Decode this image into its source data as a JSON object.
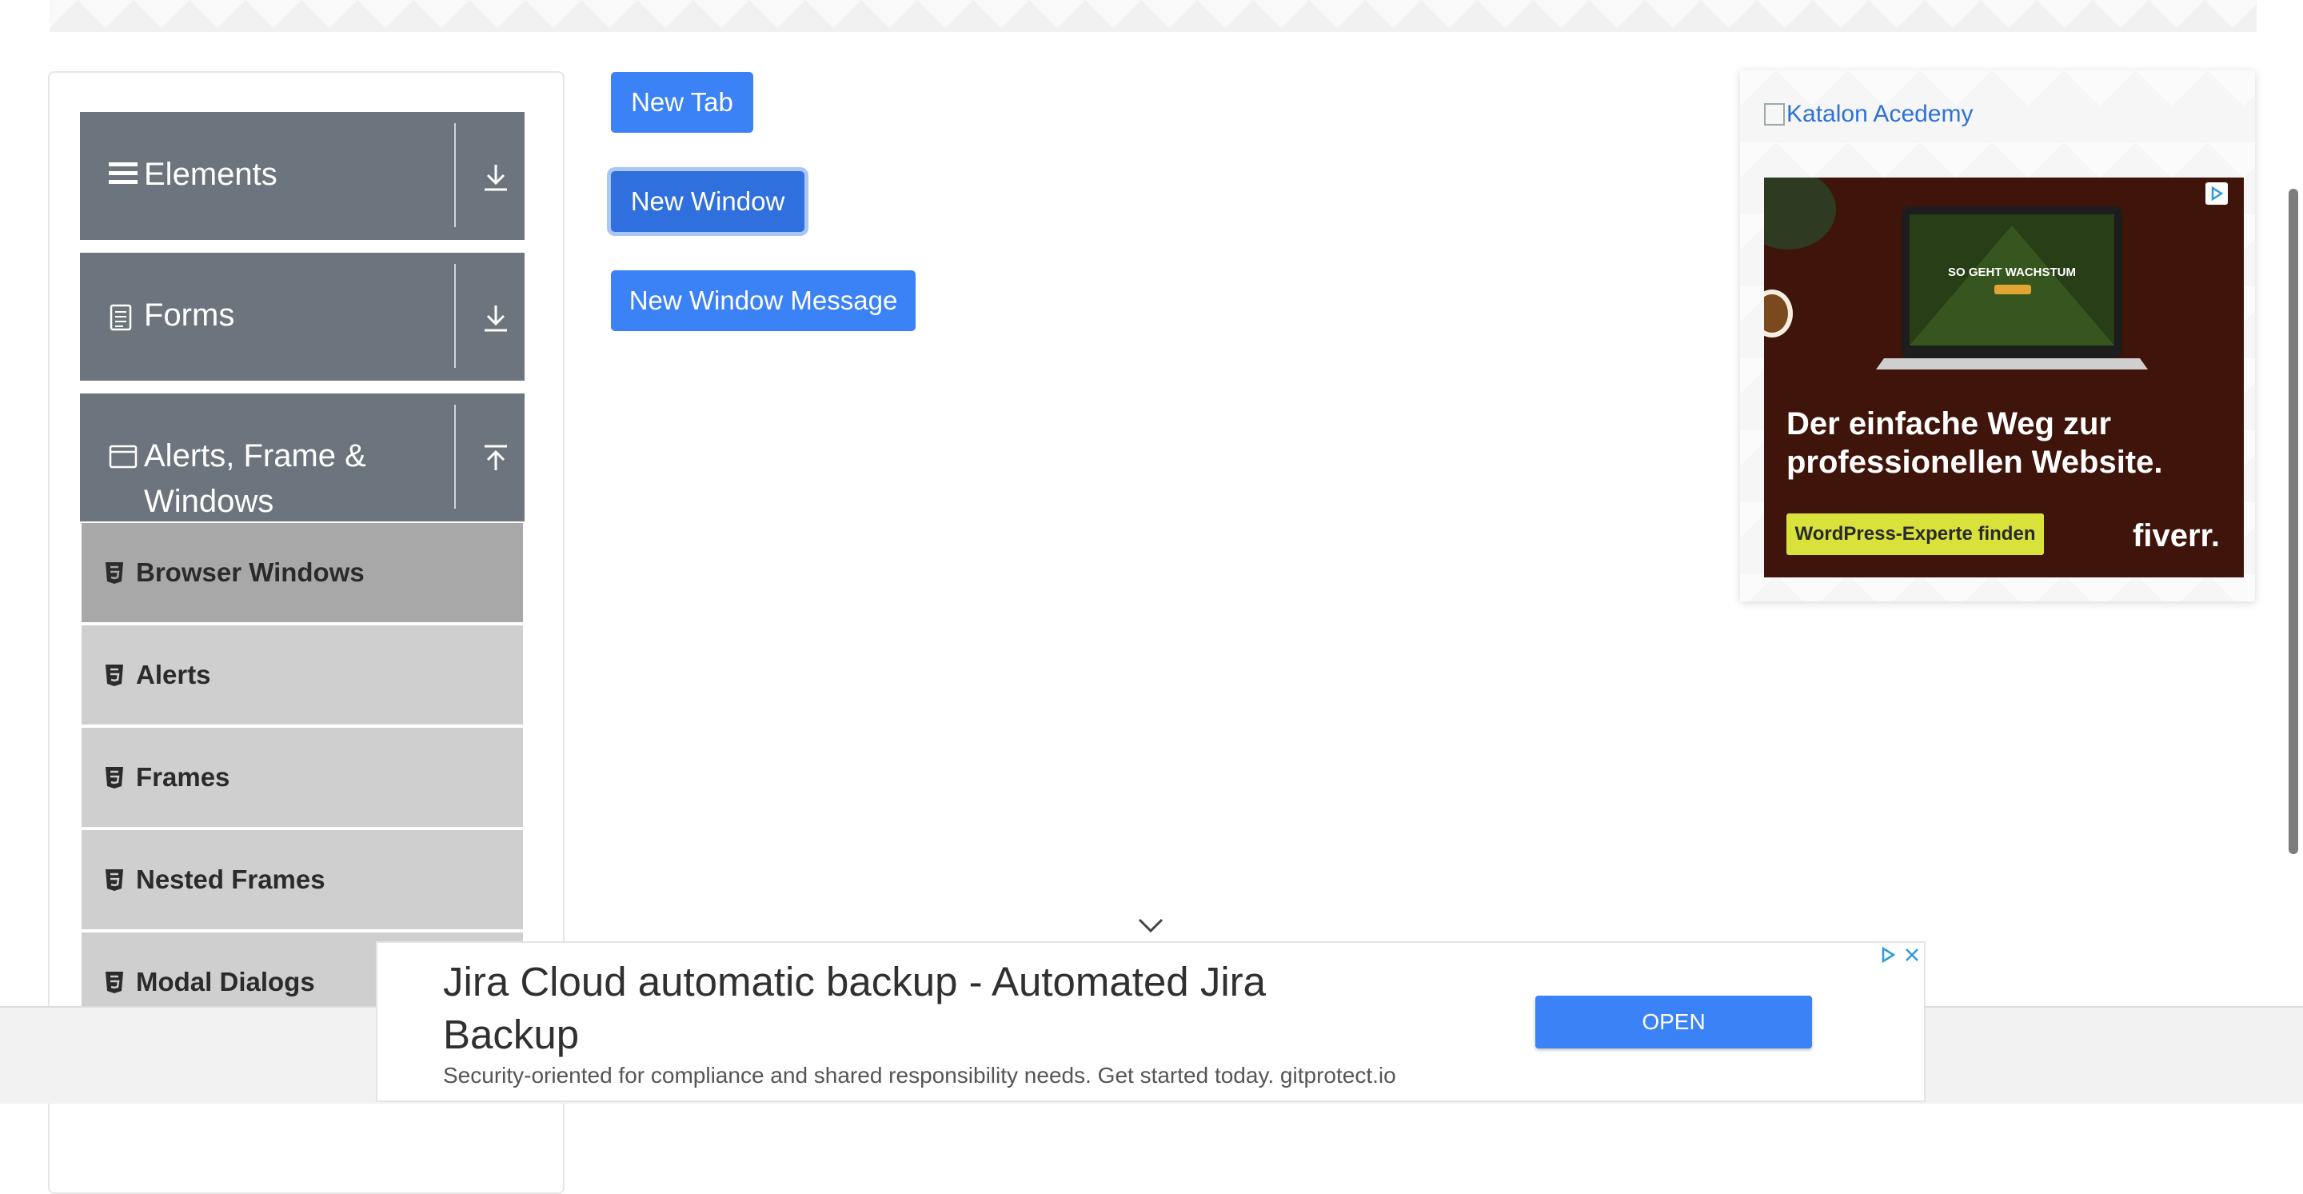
{
  "sidebar": {
    "groups": [
      {
        "label": "Elements",
        "icon": "hamburger-icon",
        "toggle": "download-icon"
      },
      {
        "label": "Forms",
        "icon": "document-icon",
        "toggle": "download-icon"
      },
      {
        "label_line1": "Alerts, Frame &",
        "label_line2": "Windows",
        "icon": "window-icon",
        "toggle": "upload-icon"
      }
    ],
    "items": [
      {
        "label": "Browser Windows",
        "active": true
      },
      {
        "label": "Alerts"
      },
      {
        "label": "Frames"
      },
      {
        "label": "Nested Frames"
      },
      {
        "label": "Modal Dialogs"
      }
    ]
  },
  "main": {
    "buttons": {
      "new_tab": "New Tab",
      "new_window": "New Window",
      "new_window_message": "New Window Message"
    }
  },
  "side_ad": {
    "link_text": "Katalon Acedemy",
    "screen_text": "SO GEHT WACHSTUM",
    "headline": "Der einfache Weg zur professionellen Website.",
    "cta": "WordPress-Experte finden",
    "brand": "fiverr."
  },
  "bottom_ad": {
    "title": "Jira Cloud automatic backup - Automated Jira Backup",
    "description": "Security-oriented for compliance and shared responsibility needs. Get started today. gitprotect.io",
    "cta": "OPEN"
  },
  "colors": {
    "sidebar_header": "#6c757d",
    "menu_item": "#cfcfcf",
    "menu_item_active": "#a8a8a8",
    "primary_button": "#3b82f6"
  }
}
